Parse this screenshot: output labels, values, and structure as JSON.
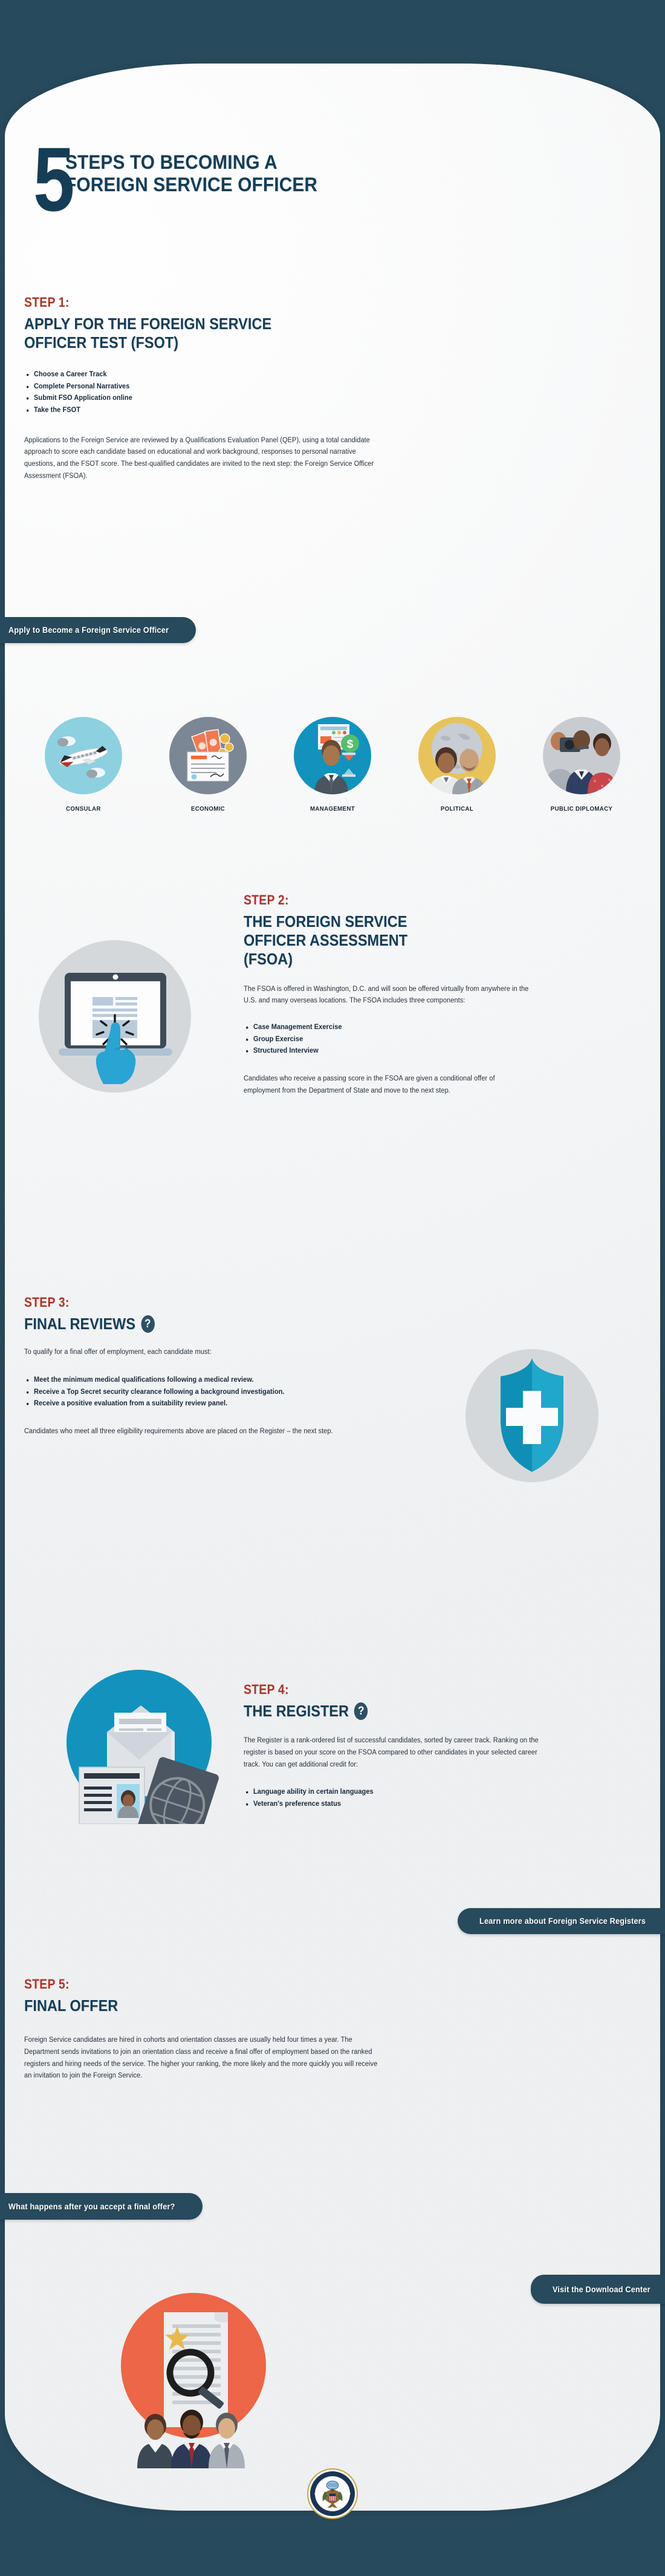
{
  "colors": {
    "navy_bg": "#274A5C",
    "paper": "#ECEEF0",
    "heading_navy": "#153D56",
    "step_red": "#A8362A",
    "button_navy": "#274A5C",
    "teal": "#1193BD",
    "orange": "#EC6647",
    "sky": "#8DD0E0",
    "slate": "#7B8794",
    "gold": "#E8C35A"
  },
  "header": {
    "number": "5",
    "title_line1": "STEPS TO BECOMING A",
    "title_line2": "FOREIGN SERVICE OFFICER"
  },
  "steps": [
    {
      "kicker": "STEP 1:",
      "title_line1": "APPLY FOR THE FOREIGN SERVICE",
      "title_line2": "OFFICER TEST (FSOT)",
      "bullets": [
        "Choose a Career Track",
        "Complete Personal Narratives",
        "Submit FSO Application online",
        "Take the FSOT"
      ],
      "paragraph": "Applications to the Foreign Service are reviewed by a Qualifications Evaluation Panel (QEP), using a total candidate approach to score each candidate based on educational and work background, responses to personal narrative questions, and the FSOT score. The best-qualified candidates are invited to the next step: the Foreign Service Officer Assessment (FSOA).",
      "button": "Apply to Become a Foreign Service Officer"
    },
    {
      "kicker": "STEP 2:",
      "title_line1": "THE FOREIGN SERVICE",
      "title_line2": "OFFICER ASSESSMENT",
      "title_line3": "(FSOA)",
      "paragraph_intro": "The FSOA is offered in Washington, D.C. and will soon be offered virtually from anywhere in the U.S. and many overseas locations. The FSOA includes three components:",
      "bullets": [
        "Case Management Exercise",
        "Group Exercise",
        "Structured Interview"
      ],
      "paragraph_after": "Candidates who receive a passing score in the FSOA are given a conditional offer of employment from the Department of State and move to the next step."
    },
    {
      "kicker": "STEP 3:",
      "title": "FINAL REVIEWS",
      "help_badge": "?",
      "paragraph_intro": "To qualify for a final offer of employment, each candidate must:",
      "bullets": [
        "Meet the minimum medical qualifications following a medical review.",
        "Receive a Top Secret security clearance following a background investigation.",
        "Receive a positive evaluation from a suitability review panel."
      ],
      "paragraph_after": "Candidates who meet all three eligibility requirements above are placed on the Register – the next step."
    },
    {
      "kicker": "STEP 4:",
      "title": "THE REGISTER",
      "help_badge": "?",
      "paragraph_intro": "The Register is a rank-ordered list of successful candidates, sorted by career track.  Ranking on the register is based on your score on the FSOA compared to other candidates in your selected career track.  You can get additional credit for:",
      "bullets": [
        "Language ability in certain languages",
        "Veteran's preference status"
      ],
      "button": "Learn more about Foreign Service Registers"
    },
    {
      "kicker": "STEP 5:",
      "title": "FINAL OFFER",
      "paragraph": "Foreign Service candidates are hired in cohorts and orientation classes are usually held four times a year. The Department sends invitations to join an orientation class and receive a final offer of employment based on the ranked registers and hiring needs of the service. The higher your ranking, the more likely and the more quickly you will receive an invitation to join the Foreign Service.",
      "button": "What happens after you accept a final offer?"
    }
  ],
  "career_tracks": [
    {
      "label": "CONSULAR",
      "icon": "airplane-icon",
      "circle_color": "#8DD0E0"
    },
    {
      "label": "ECONOMIC",
      "icon": "check-money-icon",
      "circle_color": "#7B8794"
    },
    {
      "label": "MANAGEMENT",
      "icon": "manager-chart-icon",
      "circle_color": "#1193BD"
    },
    {
      "label": "POLITICAL",
      "icon": "diplomats-globe-icon",
      "circle_color": "#E8C35A"
    },
    {
      "label": "PUBLIC DIPLOMACY",
      "icon": "press-camera-icon",
      "circle_color": "#C8CCD1"
    }
  ],
  "footer": {
    "download_button": "Visit the Download Center",
    "seal_text_top": "DEPARTMENT OF STATE",
    "seal_text_bottom": "UNITED STATES OF AMERICA"
  },
  "illustrations": {
    "step2": "laptop-click-icon",
    "step3": "shield-medical-cross-icon",
    "step4": "envelope-passport-id-icon",
    "footer": "document-magnifier-people-icon"
  }
}
